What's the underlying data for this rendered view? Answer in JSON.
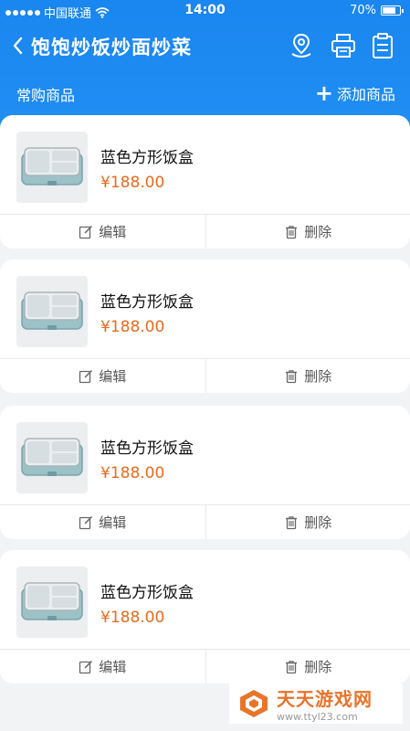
{
  "status": {
    "carrier": "中国联通",
    "time": "14:00",
    "battery": "70%"
  },
  "nav": {
    "title": "饱饱炒饭炒面炒菜",
    "icons": [
      "location-icon",
      "printer-icon",
      "clipboard-icon"
    ]
  },
  "section": {
    "title": "常购商品",
    "add_label": "添加商品"
  },
  "products": [
    {
      "name": "蓝色方形饭盒",
      "price": "¥188.00",
      "edit_label": "编辑",
      "delete_label": "删除"
    },
    {
      "name": "蓝色方形饭盒",
      "price": "¥188.00",
      "edit_label": "编辑",
      "delete_label": "删除"
    },
    {
      "name": "蓝色方形饭盒",
      "price": "¥188.00",
      "edit_label": "编辑",
      "delete_label": "删除"
    },
    {
      "name": "蓝色方形饭盒",
      "price": "¥188.00",
      "edit_label": "编辑",
      "delete_label": "删除"
    }
  ],
  "watermark": {
    "title": "天天游戏网",
    "url": "www.ttyl23.com"
  },
  "colors": {
    "primary": "#1f8df2",
    "price": "#ea6a1d"
  }
}
